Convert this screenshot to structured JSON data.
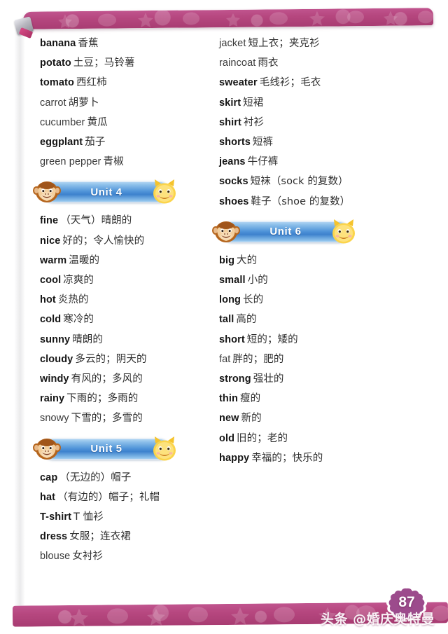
{
  "page": {
    "number": "87",
    "watermark": "头条 @婚庆奥特曼"
  },
  "columns": {
    "left": {
      "top_words": [
        {
          "en": "banana",
          "bold": true,
          "zh": "香蕉"
        },
        {
          "en": "potato",
          "bold": true,
          "zh": "土豆；马铃薯"
        },
        {
          "en": "tomato",
          "bold": true,
          "zh": "西红柿"
        },
        {
          "en": "carrot",
          "bold": false,
          "zh": "胡萝卜"
        },
        {
          "en": "cucumber",
          "bold": false,
          "zh": "黄瓜"
        },
        {
          "en": "eggplant",
          "bold": true,
          "zh": "茄子"
        },
        {
          "en": "green pepper",
          "bold": false,
          "zh": "青椒"
        }
      ],
      "unit4": {
        "label": "Unit 4",
        "words": [
          {
            "en": "fine",
            "bold": true,
            "zh": "（天气）晴朗的"
          },
          {
            "en": "nice",
            "bold": true,
            "zh": "好的；令人愉快的"
          },
          {
            "en": "warm",
            "bold": true,
            "zh": "温暖的"
          },
          {
            "en": "cool",
            "bold": true,
            "zh": "凉爽的"
          },
          {
            "en": "hot",
            "bold": true,
            "zh": "炎热的"
          },
          {
            "en": "cold",
            "bold": true,
            "zh": "寒冷的"
          },
          {
            "en": "sunny",
            "bold": true,
            "zh": "晴朗的"
          },
          {
            "en": "cloudy",
            "bold": true,
            "zh": "多云的；阴天的"
          },
          {
            "en": "windy",
            "bold": true,
            "zh": "有风的；多风的"
          },
          {
            "en": "rainy",
            "bold": true,
            "zh": "下雨的；多雨的"
          },
          {
            "en": "snowy",
            "bold": false,
            "zh": "下雪的；多雪的"
          }
        ]
      },
      "unit5": {
        "label": "Unit 5",
        "words": [
          {
            "en": "cap",
            "bold": true,
            "zh": "（无边的）帽子"
          },
          {
            "en": "hat",
            "bold": true,
            "zh": "（有边的）帽子；礼帽"
          },
          {
            "en": "T-shirt",
            "bold": true,
            "zh": "T 恤衫"
          },
          {
            "en": "dress",
            "bold": true,
            "zh": "女服；连衣裙"
          },
          {
            "en": "blouse",
            "bold": false,
            "zh": "女衬衫"
          }
        ]
      }
    },
    "right": {
      "top_words": [
        {
          "en": "jacket",
          "bold": false,
          "zh": "短上衣；夹克衫"
        },
        {
          "en": "raincoat",
          "bold": false,
          "zh": "雨衣"
        },
        {
          "en": "sweater",
          "bold": true,
          "zh": "毛线衫；毛衣"
        },
        {
          "en": "skirt",
          "bold": true,
          "zh": "短裙"
        },
        {
          "en": "shirt",
          "bold": true,
          "zh": "衬衫"
        },
        {
          "en": "shorts",
          "bold": true,
          "zh": "短裤"
        },
        {
          "en": "jeans",
          "bold": true,
          "zh": "牛仔裤"
        },
        {
          "en": "socks",
          "bold": true,
          "zh": "短袜（sock 的复数）"
        },
        {
          "en": "shoes",
          "bold": true,
          "zh": "鞋子（shoe 的复数）"
        }
      ],
      "unit6": {
        "label": "Unit 6",
        "words": [
          {
            "en": "big",
            "bold": true,
            "zh": "大的"
          },
          {
            "en": "small",
            "bold": true,
            "zh": "小的"
          },
          {
            "en": "long",
            "bold": true,
            "zh": "长的"
          },
          {
            "en": "tall",
            "bold": true,
            "zh": "高的"
          },
          {
            "en": "short",
            "bold": true,
            "zh": "短的；矮的"
          },
          {
            "en": "fat",
            "bold": false,
            "zh": "胖的；肥的"
          },
          {
            "en": "strong",
            "bold": true,
            "zh": "强壮的"
          },
          {
            "en": "thin",
            "bold": true,
            "zh": "瘦的"
          },
          {
            "en": "new",
            "bold": true,
            "zh": "新的"
          },
          {
            "en": "old",
            "bold": true,
            "zh": "旧的；老的"
          },
          {
            "en": "happy",
            "bold": true,
            "zh": "幸福的；快乐的"
          }
        ]
      }
    }
  },
  "colors": {
    "band_pink": "#b6477f",
    "banner_blue": "#4e93d8",
    "badge_purple": "#9c4b8c"
  }
}
